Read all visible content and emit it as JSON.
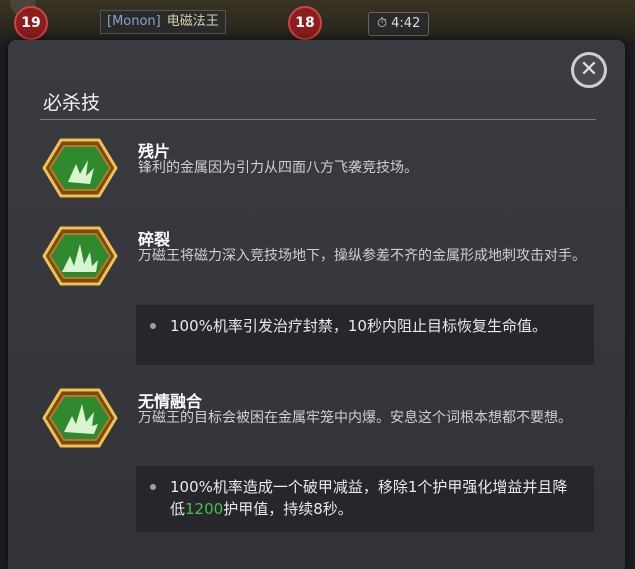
{
  "hud": {
    "left_level": "19",
    "player_tag": "[Monon]",
    "player_name": "电磁法王",
    "right_level": "18",
    "timer": "4:42"
  },
  "panel": {
    "section_title": "必杀技",
    "close_icon": "close-icon",
    "skills": [
      {
        "name": "残片",
        "desc": "锋利的金属因为引力从四面八方飞袭竞技场。",
        "icon": "metal-shard-icon"
      },
      {
        "name": "碎裂",
        "desc": "万磁王将磁力深入竞技场地下，操纵参差不齐的金属形成地刺攻击对手。",
        "icon": "shatter-icon",
        "note": "100%机率引发治疗封禁，10秒内阻止目标恢复生命值。"
      },
      {
        "name": "无情融合",
        "desc": "万磁王的目标会被困在金属牢笼中内爆。安息这个词根本想都不要想。",
        "icon": "ruthless-fusion-icon",
        "note_pre": "100%机率造成一个破甲减益，移除1个护甲强化增益并且降低",
        "note_value": "1200",
        "note_post": "护甲值，持续8秒。"
      }
    ]
  },
  "colors": {
    "panel_bg": "#36373c",
    "note_bg": "#26272b",
    "highlight_green": "#4bbf4b",
    "icon_gold": "#d49a2a",
    "icon_green": "#2f8a2f"
  }
}
